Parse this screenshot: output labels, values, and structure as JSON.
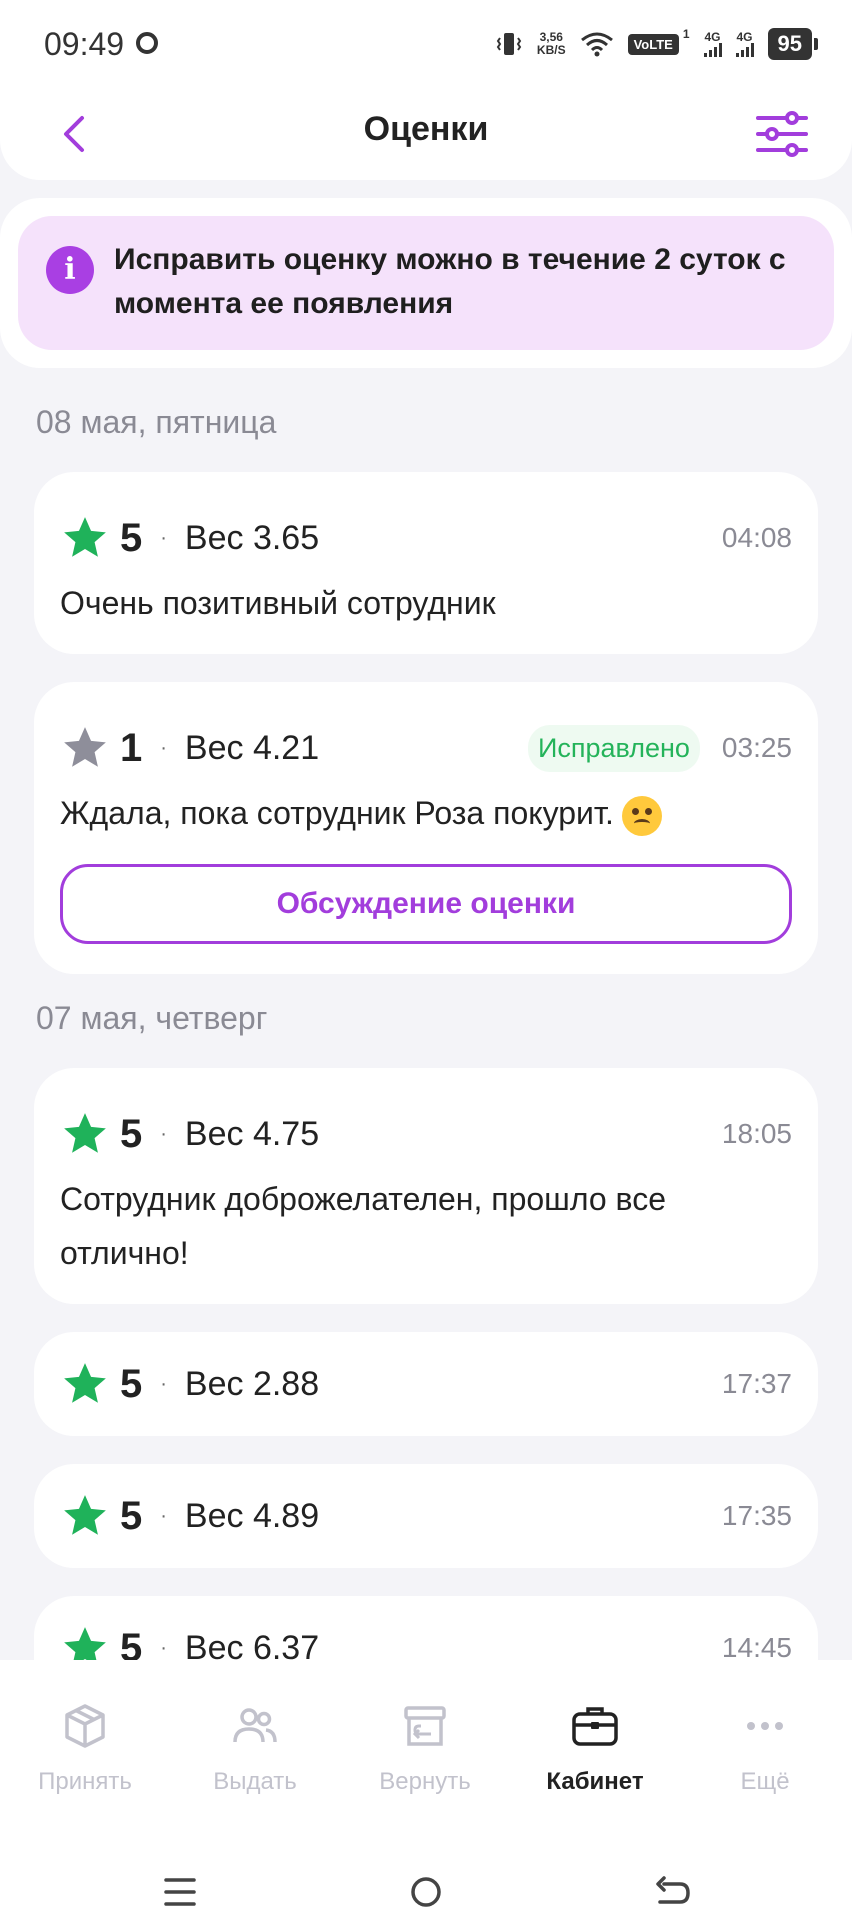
{
  "status_bar": {
    "time": "09:49",
    "speed_top": "3,56",
    "speed_unit": "KB/S",
    "volte": "VoLTE",
    "volte_sim": "1",
    "net1": "4G",
    "net2": "4G",
    "battery": "95"
  },
  "header": {
    "title": "Оценки"
  },
  "notice": {
    "icon": "i",
    "text": "Исправить оценку можно в течение 2 суток с момента ее появления"
  },
  "groups": [
    {
      "date": "08 мая, пятница",
      "ratings": [
        {
          "grade": "5",
          "weight": "Вес 3.65",
          "time": "04:08",
          "comment": "Очень позитивный сотрудник"
        },
        {
          "grade": "1",
          "weight": "Вес 4.21",
          "time": "03:25",
          "badge": "Исправлено",
          "comment": "Ждала, пока сотрудник Роза покурит.",
          "button": "Обсуждение оценки"
        }
      ]
    },
    {
      "date": "07 мая, четверг",
      "ratings": [
        {
          "grade": "5",
          "weight": "Вес 4.75",
          "time": "18:05",
          "comment": "Сотрудник доброжелателен, прошло все отлично!"
        },
        {
          "grade": "5",
          "weight": "Вес 2.88",
          "time": "17:37"
        },
        {
          "grade": "5",
          "weight": "Вес 4.89",
          "time": "17:35"
        },
        {
          "grade": "5",
          "weight": "Вес 6.37",
          "time": "14:45"
        }
      ]
    }
  ],
  "dot": "·",
  "colors": {
    "accent": "#a23ddc",
    "star_green": "#1fb25a",
    "star_gray": "#8e8e9a",
    "badge_green": "#24b35a",
    "notice_bg": "#f5e2fb"
  },
  "bottom_nav": [
    {
      "label": "Принять",
      "icon": "box-icon"
    },
    {
      "label": "Выдать",
      "icon": "users-icon"
    },
    {
      "label": "Вернуть",
      "icon": "return-box-icon"
    },
    {
      "label": "Кабинет",
      "icon": "briefcase-icon",
      "active": true
    },
    {
      "label": "Ещё",
      "icon": "more-dots-icon"
    }
  ]
}
